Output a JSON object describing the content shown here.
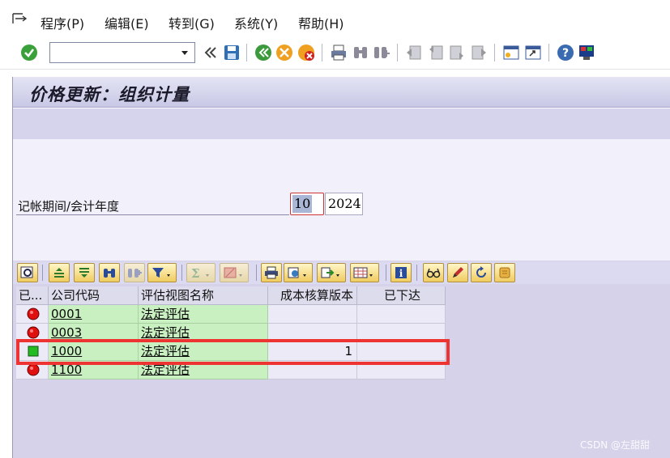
{
  "menu": {
    "items": [
      {
        "label": "程序(P)"
      },
      {
        "label": "编辑(E)"
      },
      {
        "label": "转到(G)"
      },
      {
        "label": "系统(Y)"
      },
      {
        "label": "帮助(H)"
      }
    ]
  },
  "toolbar": {
    "command_value": "",
    "icons": [
      "enter-check-icon",
      "command-field",
      "history-back-icon",
      "save-icon",
      "back-icon",
      "exit-icon",
      "cancel-icon",
      "print-icon",
      "find-icon",
      "find-next-icon",
      "first-page-icon",
      "prev-page-icon",
      "next-page-icon",
      "last-page-icon",
      "new-session-icon",
      "shortcut-icon",
      "help-icon",
      "customize-layout-icon"
    ]
  },
  "page": {
    "title": "价格更新：组织计量"
  },
  "form": {
    "period_label": "记帐期间/会计年度",
    "period_value": "10",
    "year_value": "2024"
  },
  "grid": {
    "headers": [
      "已...",
      "公司代码",
      "评估视图名称",
      "成本核算版本",
      "已下达"
    ],
    "rows": [
      {
        "status": "red",
        "company_code": "0001",
        "view_name": "法定评估",
        "version": "",
        "released": ""
      },
      {
        "status": "red",
        "company_code": "0003",
        "view_name": "法定评估",
        "version": "",
        "released": ""
      },
      {
        "status": "green",
        "company_code": "1000",
        "view_name": "法定评估",
        "version": "1",
        "released": ""
      },
      {
        "status": "red",
        "company_code": "1100",
        "view_name": "法定评估",
        "version": "",
        "released": ""
      }
    ]
  },
  "colors": {
    "status_red": "#e01010",
    "status_green": "#22bb22",
    "highlight": "#ee3333"
  },
  "watermark": "CSDN @左甜甜"
}
